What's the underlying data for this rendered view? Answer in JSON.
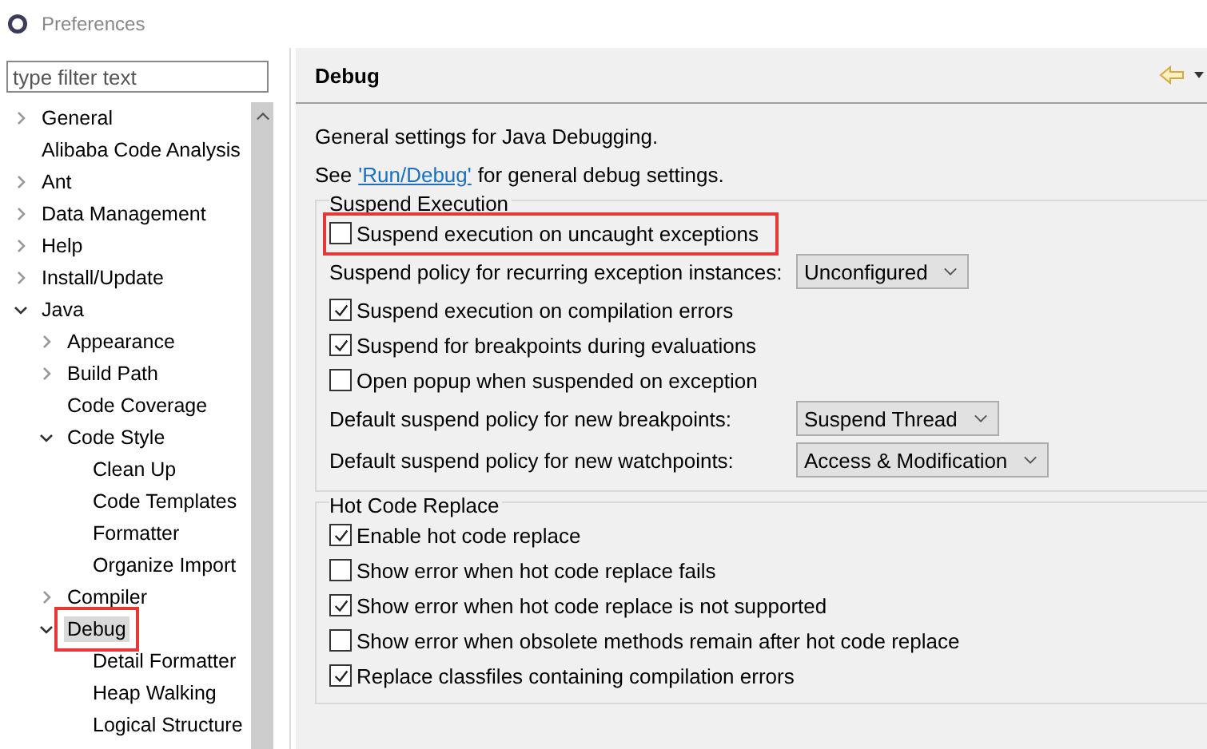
{
  "window": {
    "title": "Preferences"
  },
  "filter": {
    "placeholder": "type filter text"
  },
  "tree": [
    {
      "label": "General",
      "expanded": false,
      "selected": false,
      "highlighted": false
    },
    {
      "label": "Alibaba Code Analysis",
      "selected": false,
      "highlighted": false
    },
    {
      "label": "Ant",
      "expanded": false,
      "selected": false,
      "highlighted": false
    },
    {
      "label": "Data Management",
      "expanded": false,
      "selected": false,
      "highlighted": false
    },
    {
      "label": "Help",
      "expanded": false,
      "selected": false,
      "highlighted": false
    },
    {
      "label": "Install/Update",
      "expanded": false,
      "selected": false,
      "highlighted": false
    },
    {
      "label": "Java",
      "expanded": true,
      "selected": false,
      "highlighted": false,
      "children": [
        {
          "label": "Appearance",
          "expanded": false,
          "selected": false,
          "highlighted": false
        },
        {
          "label": "Build Path",
          "expanded": false,
          "selected": false,
          "highlighted": false
        },
        {
          "label": "Code Coverage",
          "selected": false,
          "highlighted": false
        },
        {
          "label": "Code Style",
          "expanded": true,
          "selected": false,
          "highlighted": false,
          "children": [
            {
              "label": "Clean Up",
              "selected": false,
              "highlighted": false
            },
            {
              "label": "Code Templates",
              "selected": false,
              "highlighted": false
            },
            {
              "label": "Formatter",
              "selected": false,
              "highlighted": false
            },
            {
              "label": "Organize Import",
              "selected": false,
              "highlighted": false
            }
          ]
        },
        {
          "label": "Compiler",
          "expanded": false,
          "selected": false,
          "highlighted": false
        },
        {
          "label": "Debug",
          "expanded": true,
          "selected": true,
          "highlighted": true,
          "children": [
            {
              "label": "Detail Formatter",
              "selected": false,
              "highlighted": false
            },
            {
              "label": "Heap Walking",
              "selected": false,
              "highlighted": false
            },
            {
              "label": "Logical Structure",
              "selected": false,
              "highlighted": false
            }
          ]
        }
      ]
    }
  ],
  "page": {
    "title": "Debug",
    "description": "General settings for Java Debugging.",
    "see_prefix": "See",
    "see_link": "'Run/Debug'",
    "see_suffix": "for general debug settings."
  },
  "groups": [
    {
      "title": "Suspend Execution",
      "items": [
        {
          "kind": "checkbox",
          "label": "Suspend execution on uncaught exceptions",
          "checked": false,
          "highlighted": true
        },
        {
          "kind": "combo",
          "label": "Suspend policy for recurring exception instances:",
          "value": "Unconfigured"
        },
        {
          "kind": "checkbox",
          "label": "Suspend execution on compilation errors",
          "checked": true,
          "highlighted": false
        },
        {
          "kind": "checkbox",
          "label": "Suspend for breakpoints during evaluations",
          "checked": true,
          "highlighted": false
        },
        {
          "kind": "checkbox",
          "label": "Open popup when suspended on exception",
          "checked": false,
          "highlighted": false
        },
        {
          "kind": "combo",
          "label": "Default suspend policy for new breakpoints:",
          "value": "Suspend Thread"
        },
        {
          "kind": "combo",
          "label": "Default suspend policy for new watchpoints:",
          "value": "Access & Modification"
        }
      ]
    },
    {
      "title": "Hot Code Replace",
      "items": [
        {
          "kind": "checkbox",
          "label": "Enable hot code replace",
          "checked": true,
          "highlighted": false
        },
        {
          "kind": "checkbox",
          "label": "Show error when hot code replace fails",
          "checked": false,
          "highlighted": false
        },
        {
          "kind": "checkbox",
          "label": "Show error when hot code replace is not supported",
          "checked": true,
          "highlighted": false
        },
        {
          "kind": "checkbox",
          "label": "Show error when obsolete methods remain after hot code replace",
          "checked": false,
          "highlighted": false
        },
        {
          "kind": "checkbox",
          "label": "Replace classfiles containing compilation errors",
          "checked": true,
          "highlighted": false
        }
      ]
    }
  ]
}
